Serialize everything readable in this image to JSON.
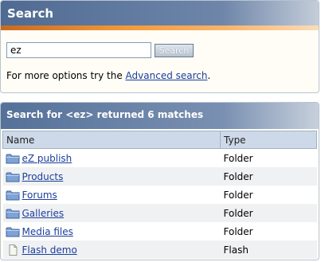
{
  "search_panel": {
    "title": "Search",
    "input_value": "ez",
    "button_label": "Search",
    "options_prefix": "For more options try the ",
    "advanced_link": "Advanced search",
    "options_suffix": "."
  },
  "results_panel": {
    "title": "Search for <ez> returned 6 matches",
    "columns": [
      "Name",
      "Type"
    ],
    "rows": [
      {
        "name": "eZ publish",
        "type": "Folder",
        "icon": "folder-icon"
      },
      {
        "name": "Products",
        "type": "Folder",
        "icon": "folder-icon"
      },
      {
        "name": "Forums",
        "type": "Folder",
        "icon": "folder-icon"
      },
      {
        "name": "Galleries",
        "type": "Folder",
        "icon": "folder-icon"
      },
      {
        "name": "Media files",
        "type": "Folder",
        "icon": "folder-icon"
      },
      {
        "name": "Flash demo",
        "type": "Flash",
        "icon": "file-icon"
      }
    ]
  },
  "colors": {
    "header_blue": "#557199",
    "accent_orange": "#f59a3a",
    "link_blue": "#1a3f9c"
  }
}
